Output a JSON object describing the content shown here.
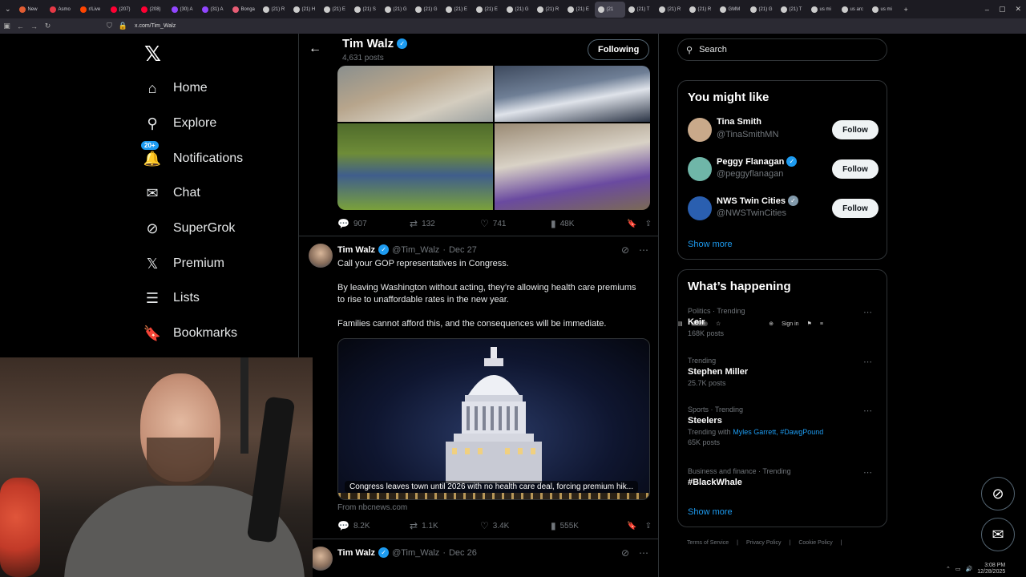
{
  "browser": {
    "tabs": [
      {
        "label": "New",
        "color": "#e25d33"
      },
      {
        "label": "Asmo",
        "color": "#e63946"
      },
      {
        "label": "r/Live",
        "color": "#ff4500"
      },
      {
        "label": "(207)",
        "color": "#ff0033"
      },
      {
        "label": "(208)",
        "color": "#ff0033"
      },
      {
        "label": "(30) A",
        "color": "#9146ff"
      },
      {
        "label": "(31) A",
        "color": "#9146ff"
      },
      {
        "label": "Bonga",
        "color": "#e85d75"
      },
      {
        "label": "(21) R",
        "color": "#cccccc"
      },
      {
        "label": "(21) H",
        "color": "#cccccc"
      },
      {
        "label": "(21) E",
        "color": "#cccccc"
      },
      {
        "label": "(21) S",
        "color": "#cccccc"
      },
      {
        "label": "(21) G",
        "color": "#cccccc"
      },
      {
        "label": "(21) G",
        "color": "#cccccc"
      },
      {
        "label": "(21) E",
        "color": "#cccccc"
      },
      {
        "label": "(21) E",
        "color": "#cccccc"
      },
      {
        "label": "(21) G",
        "color": "#cccccc"
      },
      {
        "label": "(21) R",
        "color": "#cccccc"
      },
      {
        "label": "(21) E",
        "color": "#cccccc"
      },
      {
        "label": "(21",
        "color": "#cccccc",
        "active": true
      },
      {
        "label": "(21) T",
        "color": "#cccccc"
      },
      {
        "label": "(21) R",
        "color": "#cccccc"
      },
      {
        "label": "(21) R",
        "color": "#cccccc"
      },
      {
        "label": "GMM",
        "color": "#cccccc"
      },
      {
        "label": "(21) G",
        "color": "#cccccc"
      },
      {
        "label": "(21) T",
        "color": "#cccccc"
      },
      {
        "label": "us mi",
        "color": "#cccccc"
      },
      {
        "label": "us arc",
        "color": "#cccccc"
      },
      {
        "label": "us mi",
        "color": "#cccccc"
      }
    ],
    "url": "x.com/Tim_Walz",
    "zoom": "150%",
    "signin": "Sign in"
  },
  "sidebar": {
    "items": [
      {
        "label": "Home",
        "icon": "home-icon",
        "glyph": "⌂"
      },
      {
        "label": "Explore",
        "icon": "search-icon",
        "glyph": "⚲"
      },
      {
        "label": "Notifications",
        "icon": "bell-icon",
        "glyph": "🔔",
        "badge": "20+"
      },
      {
        "label": "Chat",
        "icon": "mail-icon",
        "glyph": "✉"
      },
      {
        "label": "SuperGrok",
        "icon": "grok-icon",
        "glyph": "⊘"
      },
      {
        "label": "Premium",
        "icon": "x-icon",
        "glyph": "𝕏"
      },
      {
        "label": "Lists",
        "icon": "list-icon",
        "glyph": "☰"
      },
      {
        "label": "Bookmarks",
        "icon": "bookmark-icon",
        "glyph": "🔖"
      }
    ]
  },
  "profile_header": {
    "name": "Tim Walz",
    "posts": "4,631 posts",
    "following_label": "Following"
  },
  "tweet1": {
    "replies": "907",
    "reposts": "132",
    "likes": "741",
    "views": "48K"
  },
  "tweet2": {
    "name": "Tim Walz",
    "handle": "@Tim_Walz",
    "date": "Dec 27",
    "lines": [
      "Call your GOP representatives in Congress.",
      "By leaving Washington without acting, they’re allowing health care premiums to rise to unaffordable rates in the new year.",
      "Families cannot afford this, and the consequences will be immediate."
    ],
    "card_caption": "Congress leaves town until 2026 with no health care deal, forcing premium hik...",
    "card_from": "From nbcnews.com",
    "replies": "8.2K",
    "reposts": "1.1K",
    "likes": "3.4K",
    "views": "555K"
  },
  "tweet3": {
    "name": "Tim Walz",
    "handle": "@Tim_Walz",
    "date": "Dec 26"
  },
  "right": {
    "search_placeholder": "Search",
    "you_might_like": "You might like",
    "suggestions": [
      {
        "name": "Tina Smith",
        "handle": "@TinaSmithMN",
        "verified": false,
        "button": "Follow",
        "avatar_color": "#c9a98a"
      },
      {
        "name": "Peggy Flanagan",
        "handle": "@peggyflanagan",
        "verified": true,
        "button": "Follow",
        "avatar_color": "#6fb6a8"
      },
      {
        "name": "NWS Twin Cities",
        "handle": "@NWSTwinCities",
        "verified": true,
        "button": "Follow",
        "avatar_color": "#2a5fb0"
      }
    ],
    "show_more_1": "Show more",
    "whats_happening": "What’s happening",
    "trends": [
      {
        "category": "Politics · Trending",
        "title": "Keir",
        "count": "168K posts"
      },
      {
        "category": "Trending",
        "title": "Stephen Miller",
        "count": "25.7K posts"
      },
      {
        "category": "Sports · Trending",
        "title": "Steelers",
        "with_prefix": "Trending with",
        "with_links": "Myles Garrett, #DawgPound",
        "count": "65K posts"
      },
      {
        "category": "Business and finance · Trending",
        "title": "#BlackWhale"
      }
    ],
    "show_more_2": "Show more",
    "footer": [
      "Terms of Service",
      "|",
      "Privacy Policy",
      "|",
      "Cookie Policy",
      "|"
    ]
  },
  "taskbar": {
    "time": "3:08 PM",
    "date": "12/28/2025"
  }
}
